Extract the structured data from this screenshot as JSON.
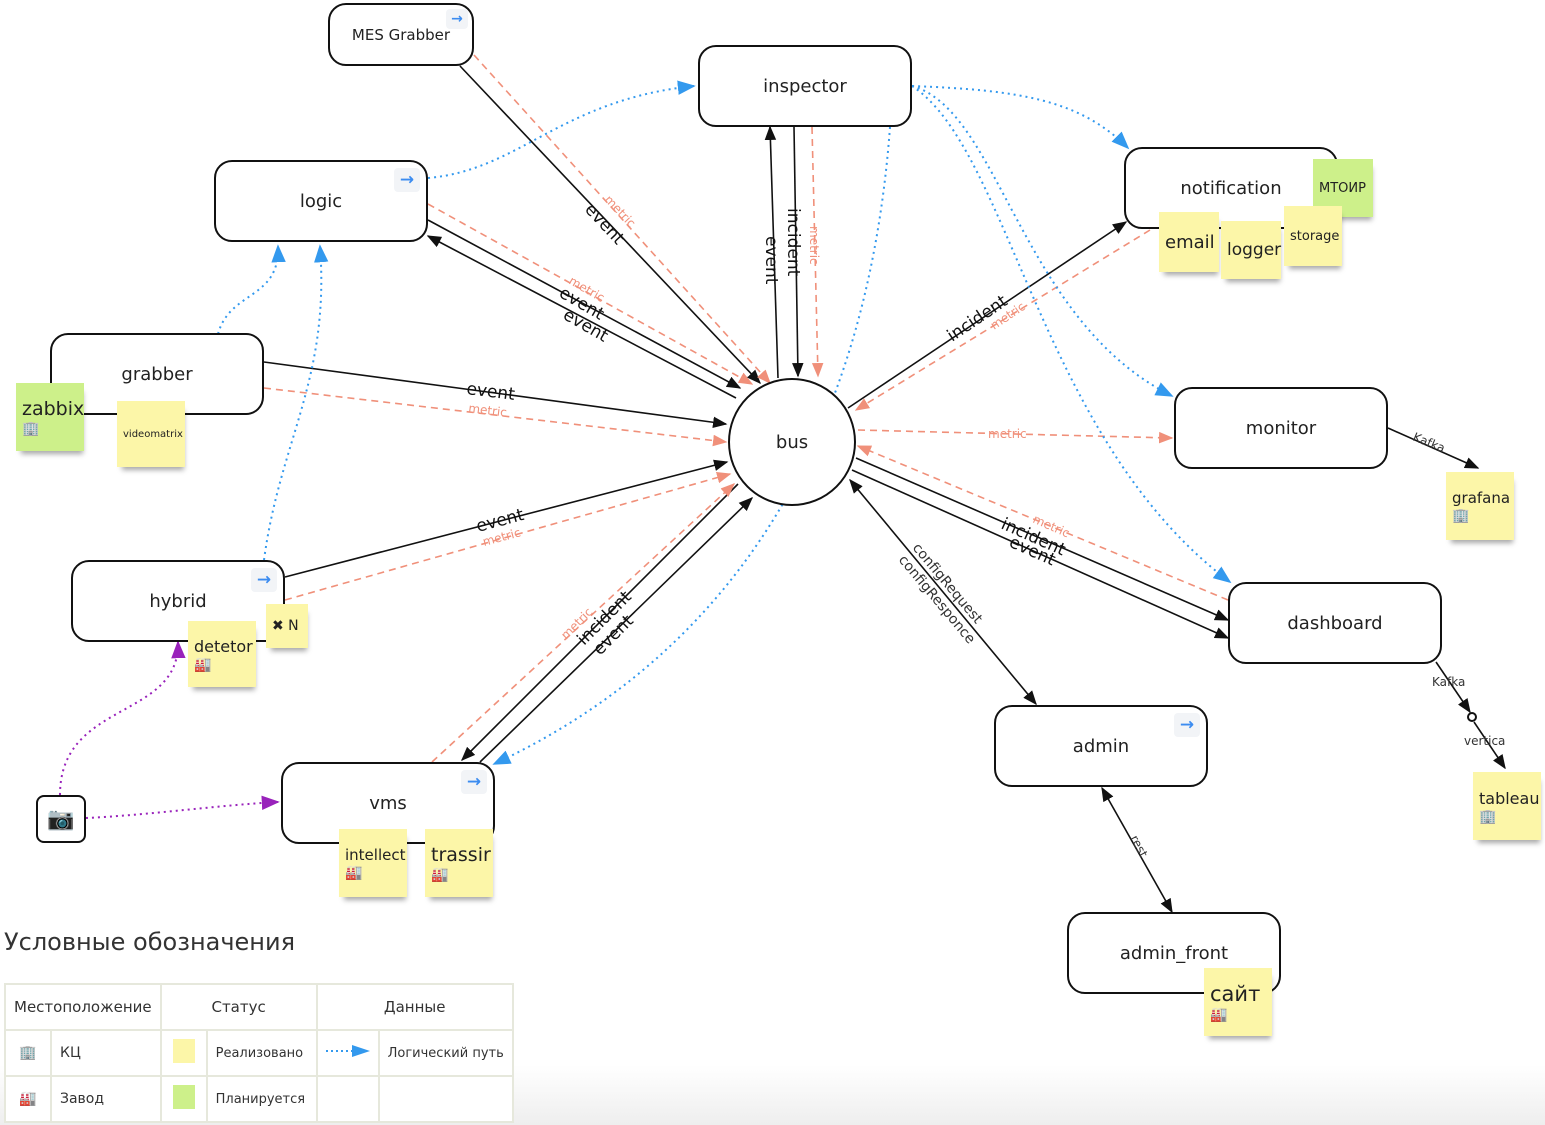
{
  "nodes": {
    "mes_grabber": "MES Grabber",
    "inspector": "inspector",
    "logic": "logic",
    "notification": "notification",
    "grabber": "grabber",
    "bus": "bus",
    "monitor": "monitor",
    "hybrid": "hybrid",
    "dashboard": "dashboard",
    "admin": "admin",
    "vms": "vms",
    "admin_front": "admin_front"
  },
  "link_icon": "→",
  "stickies": {
    "zabbix": "zabbix",
    "videomatrix": "videomatrix",
    "mtoir": "МТОИР",
    "email": "email",
    "logger": "logger",
    "storage": "storage",
    "grafana": "grafana",
    "tableau": "tableau",
    "detetor": "detetor",
    "n_multiplier": "✖ N",
    "intellect": "intellect",
    "trassir": "trassir",
    "sait": "сайт"
  },
  "icons": {
    "building": "🏢",
    "factory": "🏭",
    "camera": "📷"
  },
  "edge_labels": {
    "event": "event",
    "metric": "metric",
    "incident": "incident",
    "config_request": "configRequest",
    "config_response": "configResponce",
    "kafka": "Kafka",
    "vertica": "vertica",
    "rest": "rest"
  },
  "colors": {
    "sticky_implemented": "#fcf6a8",
    "sticky_planned": "#cdf08a",
    "metric_edge": "#f0907a",
    "logical_path": "#3399ee",
    "camera_path": "#9922bb"
  },
  "legend": {
    "title": "Условные обозначения",
    "headers": [
      "Местоположение",
      "Статус",
      "Данные"
    ],
    "rows": [
      {
        "location_icon": "🏢",
        "location": "КЦ",
        "status": "Реализовано",
        "data": "Логический путь"
      },
      {
        "location_icon": "🏭",
        "location": "Завод",
        "status": "Планируется",
        "data": ""
      }
    ]
  }
}
